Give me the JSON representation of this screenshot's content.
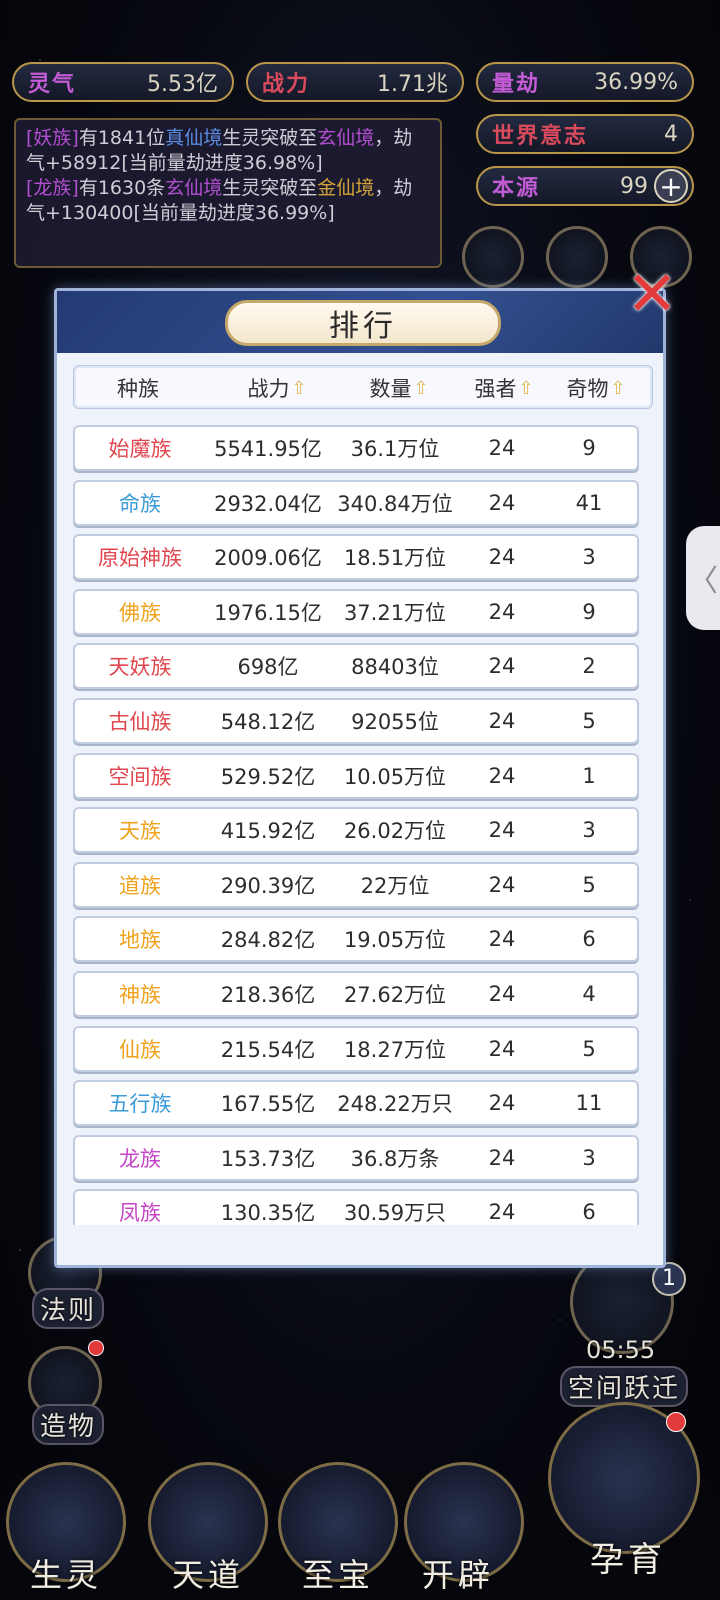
{
  "stats": {
    "lingqi": {
      "label": "灵气",
      "value": "5.53亿"
    },
    "zhanli": {
      "label": "战力",
      "value": "1.71兆"
    },
    "liangjie": {
      "label": "量劫",
      "value": "36.99%"
    },
    "shijie": {
      "label": "世界意志",
      "value": "4"
    },
    "benyuan": {
      "label": "本源",
      "value": "99"
    }
  },
  "log": {
    "line1": {
      "race": "[妖族]",
      "t1": "有1841位",
      "realm_from": "真仙境",
      "t2": "生灵突破至",
      "realm_to": "玄仙境",
      "t3": "，劫气+58912[当前量劫进度36.98%]"
    },
    "line2": {
      "race": "[龙族]",
      "t1": "有1630条",
      "realm_from": "玄仙境",
      "t2": "生灵突破至",
      "realm_to": "金仙境",
      "t3": "，劫气+130400[当前量劫进度36.99%]"
    }
  },
  "panel": {
    "title": "排行",
    "close_label": "✕",
    "headers": {
      "race": "种族",
      "power": "战力",
      "count": "数量",
      "strong": "强者",
      "treasure": "奇物"
    },
    "rows": [
      {
        "race": "始魔族",
        "power": "5541.95亿",
        "count": "36.1万位",
        "strong": "24",
        "treasure": "9",
        "color": "#e0474f"
      },
      {
        "race": "命族",
        "power": "2932.04亿",
        "count": "340.84万位",
        "strong": "24",
        "treasure": "41",
        "color": "#3b9ad8"
      },
      {
        "race": "原始神族",
        "power": "2009.06亿",
        "count": "18.51万位",
        "strong": "24",
        "treasure": "3",
        "color": "#e0474f"
      },
      {
        "race": "佛族",
        "power": "1976.15亿",
        "count": "37.21万位",
        "strong": "24",
        "treasure": "9",
        "color": "#f0a21c"
      },
      {
        "race": "天妖族",
        "power": "698亿",
        "count": "88403位",
        "strong": "24",
        "treasure": "2",
        "color": "#e0474f"
      },
      {
        "race": "古仙族",
        "power": "548.12亿",
        "count": "92055位",
        "strong": "24",
        "treasure": "5",
        "color": "#e0474f"
      },
      {
        "race": "空间族",
        "power": "529.52亿",
        "count": "10.05万位",
        "strong": "24",
        "treasure": "1",
        "color": "#e0474f"
      },
      {
        "race": "天族",
        "power": "415.92亿",
        "count": "26.02万位",
        "strong": "24",
        "treasure": "3",
        "color": "#f0a21c"
      },
      {
        "race": "道族",
        "power": "290.39亿",
        "count": "22万位",
        "strong": "24",
        "treasure": "5",
        "color": "#f0a21c"
      },
      {
        "race": "地族",
        "power": "284.82亿",
        "count": "19.05万位",
        "strong": "24",
        "treasure": "6",
        "color": "#f0a21c"
      },
      {
        "race": "神族",
        "power": "218.36亿",
        "count": "27.62万位",
        "strong": "24",
        "treasure": "4",
        "color": "#f0a21c"
      },
      {
        "race": "仙族",
        "power": "215.54亿",
        "count": "18.27万位",
        "strong": "24",
        "treasure": "5",
        "color": "#f0a21c"
      },
      {
        "race": "五行族",
        "power": "167.55亿",
        "count": "248.22万只",
        "strong": "24",
        "treasure": "11",
        "color": "#3b9ad8"
      },
      {
        "race": "龙族",
        "power": "153.73亿",
        "count": "36.8万条",
        "strong": "24",
        "treasure": "3",
        "color": "#c545c8"
      },
      {
        "race": "凤族",
        "power": "130.35亿",
        "count": "30.59万只",
        "strong": "24",
        "treasure": "6",
        "color": "#c545c8"
      }
    ]
  },
  "side": {
    "fa_ze": "法则",
    "zao_wu": "造物",
    "timer": "05:55",
    "kongjian": "空间跃迁",
    "badge": "1",
    "tab_arrow": "〈"
  },
  "bottom": {
    "sheng_ling": "生灵",
    "tian_dao": "天道",
    "zhi_bao": "至宝",
    "kai_pi": "开辟",
    "yun_yu": "孕育"
  }
}
